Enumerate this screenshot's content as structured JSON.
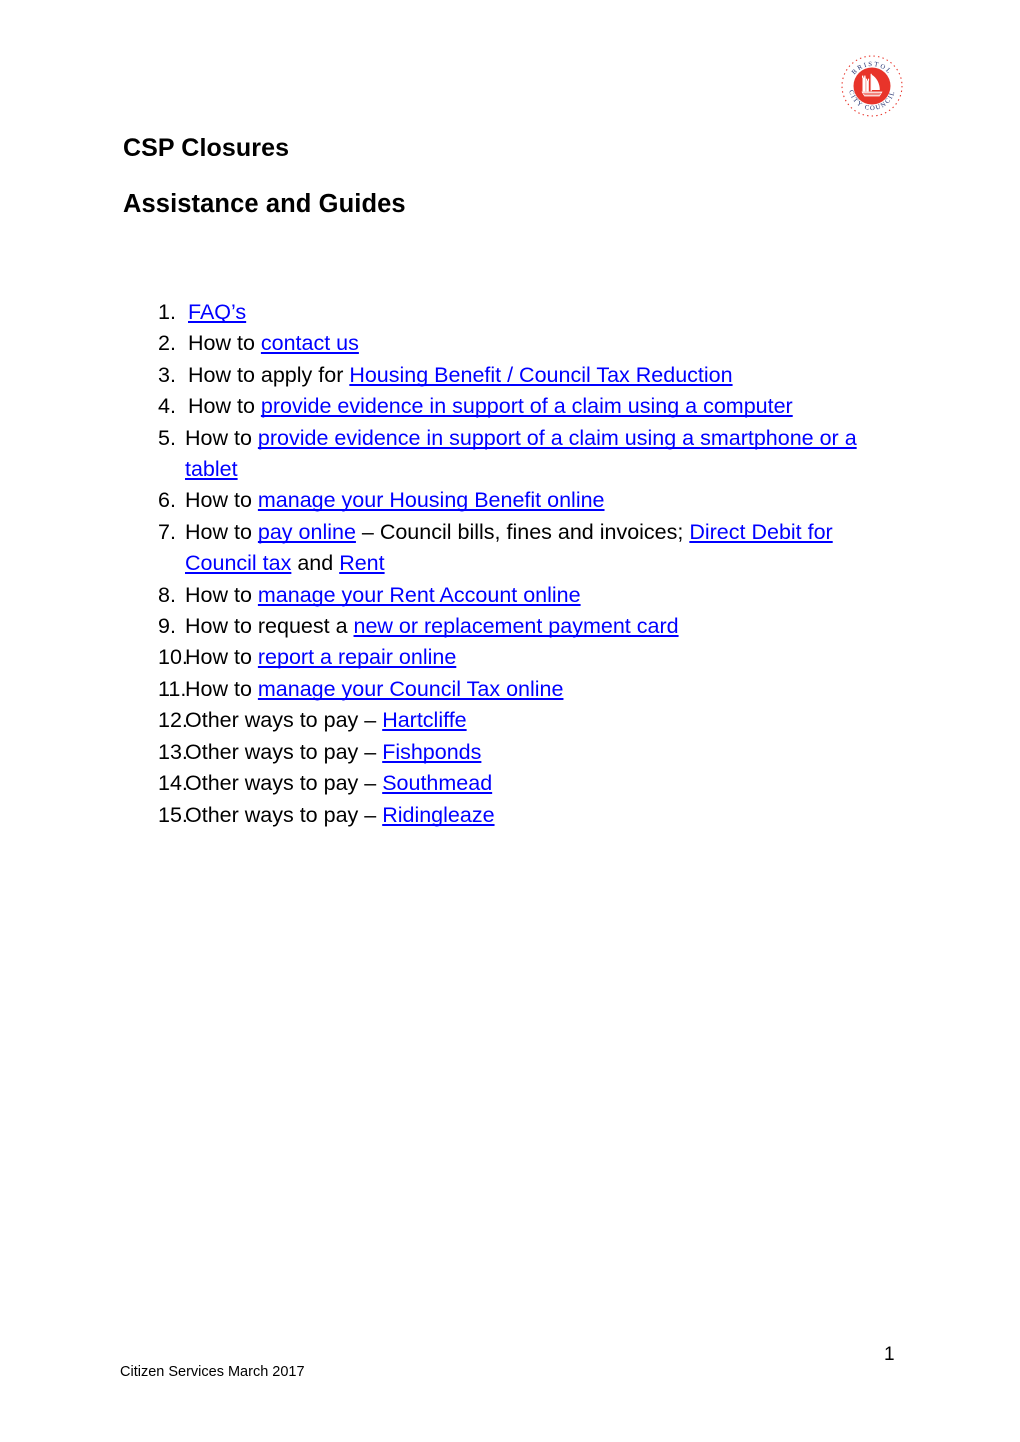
{
  "document": {
    "title": "CSP Closures",
    "subtitle": "Assistance and Guides"
  },
  "logo": {
    "name": "bristol-city-council-logo",
    "top_arc_text": "BRISTOL",
    "bottom_arc_text": "CITY COUNCIL",
    "color": "#e8342a"
  },
  "link_color": "#0000ff",
  "list": {
    "items": [
      {
        "number": "1.",
        "segments": [
          {
            "text": "FAQ’s",
            "link": true
          }
        ]
      },
      {
        "number": "2.",
        "segments": [
          {
            "text": "How to ",
            "link": false
          },
          {
            "text": "contact us",
            "link": true
          }
        ]
      },
      {
        "number": "3.",
        "segments": [
          {
            "text": "How to apply for ",
            "link": false
          },
          {
            "text": "Housing Benefit / Council Tax Reduction",
            "link": true
          }
        ]
      },
      {
        "number": "4.",
        "segments": [
          {
            "text": "How to ",
            "link": false
          },
          {
            "text": "provide evidence in support of a claim using a computer",
            "link": true
          }
        ]
      },
      {
        "number": "5.",
        "segments": [
          {
            "text": "How to ",
            "link": false
          },
          {
            "text": "provide evidence in support of a claim using a smartphone or a tablet",
            "link": true
          }
        ]
      },
      {
        "number": "6.",
        "segments": [
          {
            "text": "How to ",
            "link": false
          },
          {
            "text": "manage your Housing Benefit online",
            "link": true
          }
        ]
      },
      {
        "number": "7.",
        "segments": [
          {
            "text": "How to ",
            "link": false
          },
          {
            "text": "pay online",
            "link": true
          },
          {
            "text": " – Council bills, fines and invoices; ",
            "link": false
          },
          {
            "text": "Direct Debit for Council tax",
            "link": true
          },
          {
            "text": " and ",
            "link": false
          },
          {
            "text": "Rent",
            "link": true
          }
        ]
      },
      {
        "number": "8.",
        "segments": [
          {
            "text": "How to ",
            "link": false
          },
          {
            "text": "manage your Rent Account online",
            "link": true
          }
        ]
      },
      {
        "number": "9.",
        "segments": [
          {
            "text": "How to request a ",
            "link": false
          },
          {
            "text": "new or replacement payment card",
            "link": true
          }
        ]
      },
      {
        "number": "10.",
        "segments": [
          {
            "text": "How to ",
            "link": false
          },
          {
            "text": "report a repair online",
            "link": true
          }
        ]
      },
      {
        "number": "11.",
        "segments": [
          {
            "text": "How to ",
            "link": false
          },
          {
            "text": "manage your Council Tax online",
            "link": true
          }
        ]
      },
      {
        "number": "12.",
        "segments": [
          {
            "text": "Other ways to pay – ",
            "link": false
          },
          {
            "text": "Hartcliffe",
            "link": true
          }
        ]
      },
      {
        "number": "13.",
        "segments": [
          {
            "text": "Other ways to pay – ",
            "link": false
          },
          {
            "text": "Fishponds",
            "link": true
          }
        ]
      },
      {
        "number": "14.",
        "segments": [
          {
            "text": "Other ways to pay – ",
            "link": false
          },
          {
            "text": "Southmead",
            "link": true
          }
        ]
      },
      {
        "number": "15.",
        "segments": [
          {
            "text": "Other ways to pay – ",
            "link": false
          },
          {
            "text": "Ridingleaze",
            "link": true
          }
        ]
      }
    ]
  },
  "footer": {
    "page_number": "1",
    "note": "Citizen Services March 2017"
  }
}
